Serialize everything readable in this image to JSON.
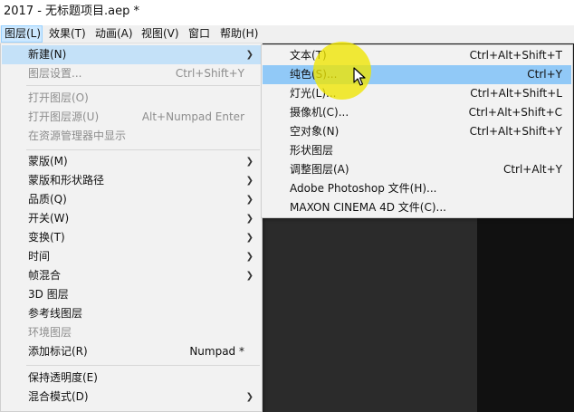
{
  "window": {
    "title": "2017 - 无标题项目.aep *"
  },
  "menubar": {
    "items": [
      {
        "label": "图层(L)",
        "active": true
      },
      {
        "label": "效果(T)"
      },
      {
        "label": "动画(A)"
      },
      {
        "label": "视图(V)"
      },
      {
        "label": "窗口"
      },
      {
        "label": "帮助(H)"
      }
    ]
  },
  "layer_menu": {
    "items": [
      {
        "label": "新建(N)",
        "submenu": true
      },
      {
        "label": "图层设置...",
        "shortcut": "Ctrl+Shift+Y",
        "disabled": true
      },
      {
        "label": "打开图层(O)",
        "disabled": true
      },
      {
        "label": "打开图层源(U)",
        "shortcut": "Alt+Numpad Enter",
        "disabled": true
      },
      {
        "label": "在资源管理器中显示",
        "disabled": true
      },
      {
        "label": "蒙版(M)",
        "submenu": true
      },
      {
        "label": "蒙版和形状路径",
        "submenu": true
      },
      {
        "label": "品质(Q)",
        "submenu": true
      },
      {
        "label": "开关(W)",
        "submenu": true
      },
      {
        "label": "变换(T)",
        "submenu": true
      },
      {
        "label": "时间",
        "submenu": true
      },
      {
        "label": "帧混合",
        "submenu": true
      },
      {
        "label": "3D 图层"
      },
      {
        "label": "参考线图层"
      },
      {
        "label": "环境图层",
        "disabled": true
      },
      {
        "label": "添加标记(R)",
        "shortcut": "Numpad *"
      },
      {
        "label": "保持透明度(E)"
      },
      {
        "label": "混合模式(D)",
        "submenu": true
      }
    ]
  },
  "new_submenu": {
    "items": [
      {
        "label": "文本(T)",
        "shortcut": "Ctrl+Alt+Shift+T"
      },
      {
        "label": "纯色(S)...",
        "shortcut": "Ctrl+Y",
        "highlighted": true
      },
      {
        "label": "灯光(L)...",
        "shortcut": "Ctrl+Alt+Shift+L"
      },
      {
        "label": "摄像机(C)...",
        "shortcut": "Ctrl+Alt+Shift+C"
      },
      {
        "label": "空对象(N)",
        "shortcut": "Ctrl+Alt+Shift+Y"
      },
      {
        "label": "形状图层"
      },
      {
        "label": "调整图层(A)",
        "shortcut": "Ctrl+Alt+Y"
      },
      {
        "label": "Adobe Photoshop 文件(H)..."
      },
      {
        "label": "MAXON CINEMA 4D 文件(C)..."
      }
    ]
  },
  "icons": {
    "submenu_arrow": "chevron-right-icon",
    "cursor": "mouse-pointer-icon"
  },
  "colors": {
    "highlight": "#91c9f7",
    "hover": "#c4e1f8",
    "cursor_spotlight": "#f0e600"
  }
}
